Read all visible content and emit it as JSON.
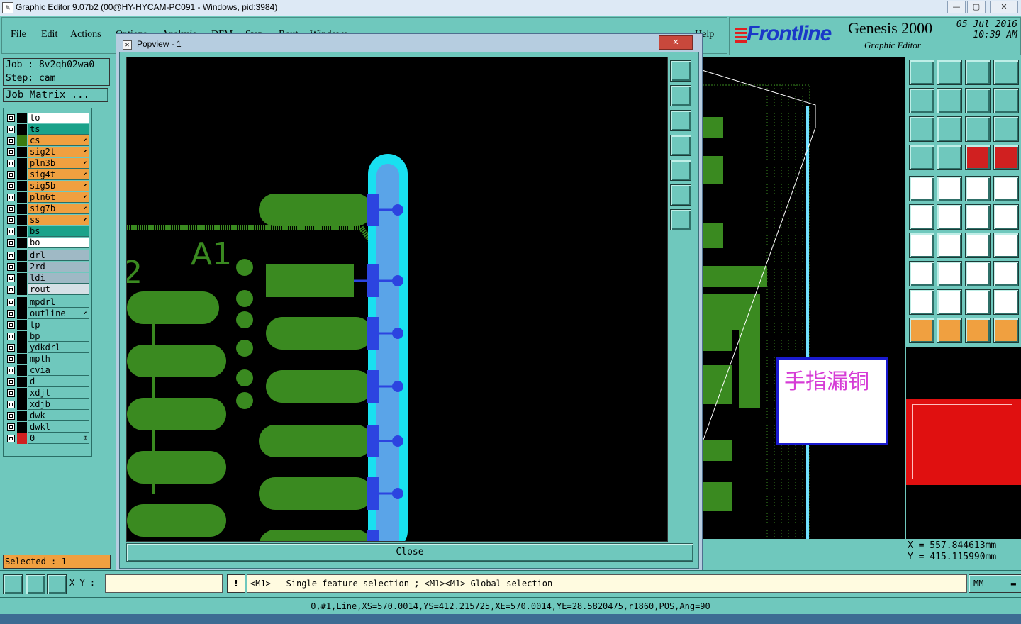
{
  "window": {
    "title": "Graphic Editor 9.07b2 (00@HY-HYCAM-PC091 - Windows, pid:3984)",
    "min": "—",
    "max": "▢",
    "close": "✕"
  },
  "menu": [
    "File",
    "Edit",
    "Actions",
    "Options",
    "Analysis",
    "DFM",
    "Step",
    "Rout",
    "Windows"
  ],
  "menu_help": "Help",
  "logo": {
    "brand": "Frontline",
    "product": "Genesis 2000",
    "subtitle": "Graphic Editor",
    "date": "05 Jul 2016",
    "time": "10:39 AM"
  },
  "job": {
    "job_line": "Job : 8v2qh02wa0",
    "step_line": "Step: cam",
    "matrix_button": "Job Matrix ..."
  },
  "layers": [
    {
      "name": "to",
      "color": "#ffffff",
      "swatch": "#000000"
    },
    {
      "name": "ts",
      "color": "#1aa28a",
      "swatch": "#000000"
    },
    {
      "name": "cs",
      "color": "#f0a040",
      "swatch": "#3a7a10",
      "sig": "⬋"
    },
    {
      "name": "sig2t",
      "color": "#f0a040",
      "swatch": "#000000",
      "sig": "⬋"
    },
    {
      "name": "pln3b",
      "color": "#f0a040",
      "swatch": "#000000",
      "sig": "⬋"
    },
    {
      "name": "sig4t",
      "color": "#f0a040",
      "swatch": "#000000",
      "sig": "⬋"
    },
    {
      "name": "sig5b",
      "color": "#f0a040",
      "swatch": "#000000",
      "sig": "⬋"
    },
    {
      "name": "pln6t",
      "color": "#f0a040",
      "swatch": "#000000",
      "sig": "⬋"
    },
    {
      "name": "sig7b",
      "color": "#f0a040",
      "swatch": "#000000",
      "sig": "⬋"
    },
    {
      "name": "ss",
      "color": "#f0a040",
      "swatch": "#000000",
      "sig": "⬋"
    },
    {
      "name": "bs",
      "color": "#1aa28a",
      "swatch": "#000000"
    },
    {
      "name": "bo",
      "color": "#ffffff",
      "swatch": "#000000"
    },
    {
      "name": "drl",
      "color": "#9fb9c5",
      "swatch": "#000000",
      "gap": true
    },
    {
      "name": "2rd",
      "color": "#9fb9c5",
      "swatch": "#000000"
    },
    {
      "name": "ldi",
      "color": "#9fb9c5",
      "swatch": "#000000"
    },
    {
      "name": "rout",
      "color": "#d6e0e6",
      "swatch": "#000000"
    },
    {
      "name": "mpdrl",
      "color": "#6fc8bd",
      "swatch": "#000000",
      "gap": true
    },
    {
      "name": "outline",
      "color": "#6fc8bd",
      "swatch": "#000000",
      "sig": "⬋"
    },
    {
      "name": "tp",
      "color": "#6fc8bd",
      "swatch": "#000000"
    },
    {
      "name": "bp",
      "color": "#6fc8bd",
      "swatch": "#000000"
    },
    {
      "name": "ydkdrl",
      "color": "#6fc8bd",
      "swatch": "#000000"
    },
    {
      "name": "mpth",
      "color": "#6fc8bd",
      "swatch": "#000000"
    },
    {
      "name": "cvia",
      "color": "#6fc8bd",
      "swatch": "#000000"
    },
    {
      "name": "d",
      "color": "#6fc8bd",
      "swatch": "#000000"
    },
    {
      "name": "xdjt",
      "color": "#6fc8bd",
      "swatch": "#000000"
    },
    {
      "name": "xdjb",
      "color": "#6fc8bd",
      "swatch": "#000000"
    },
    {
      "name": "dwk",
      "color": "#6fc8bd",
      "swatch": "#000000"
    },
    {
      "name": "dwkl",
      "color": "#6fc8bd",
      "swatch": "#000000"
    },
    {
      "name": "0",
      "color": "#6fc8bd",
      "swatch": "#d02020",
      "sig": "⊞"
    }
  ],
  "popview": {
    "title": "Popview - 1",
    "close_x": "✕",
    "close_button": "Close",
    "silk_label": "A1",
    "silk_label_2": "2"
  },
  "annotation": "手指漏铜",
  "selected": "Selected : 1",
  "bottom": {
    "xy_label": "X Y :",
    "warn": "!",
    "message": "<M1> - Single feature selection ; <M1><M1> Global selection",
    "units": "MM"
  },
  "coords": {
    "x": "X  =  557.844613mm",
    "y": "Y  =  415.115990mm"
  },
  "status": "0,#1,Line,XS=570.0014,YS=412.215725,XE=570.0014,YE=28.5820475,r1860,POS,Ang=90"
}
